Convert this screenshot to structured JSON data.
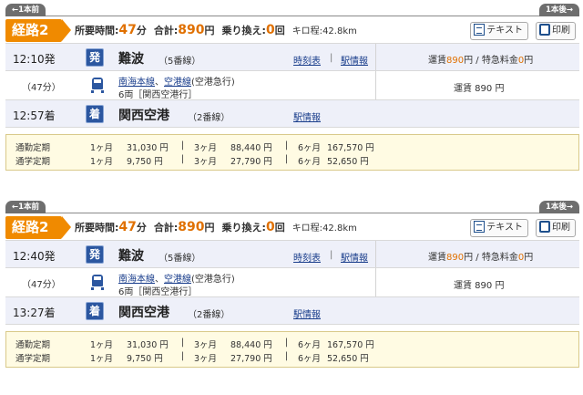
{
  "routes": [
    {
      "nav_prev": "←1本前",
      "nav_next": "1本後→",
      "badge": "経路2",
      "summary": {
        "time_label": "所要時間:",
        "time_value": "47",
        "time_unit": "分",
        "total_label": "合計:",
        "total_value": "890",
        "total_unit": "円",
        "transfer_label": "乗り換え:",
        "transfer_value": "0",
        "transfer_unit": "回",
        "distance_label": "キロ程:",
        "distance_value": "42.8km"
      },
      "buttons": {
        "text": "テキスト",
        "print": "印刷"
      },
      "depart": {
        "time": "12:10発",
        "badge": "発",
        "station": "難波",
        "platform": "（5番線）",
        "timetable": "時刻表",
        "sep": "|",
        "station_info": "駅情報",
        "fare_prefix": "運賃",
        "fare_value": "890",
        "fare_mid": "円 / 特急料金",
        "express_value": "0",
        "fare_suffix": "円"
      },
      "segment": {
        "duration": "（47分）",
        "line1": "南海本線",
        "line_sep": "、",
        "line2": "空港線",
        "line_type": "(空港急行)",
        "cars": "6両［関西空港行］",
        "fare": "運賃 890 円"
      },
      "arrive": {
        "time": "12:57着",
        "badge": "着",
        "station": "関西空港",
        "platform": "（2番線）",
        "station_info": "駅情報"
      },
      "passes": [
        {
          "type": "通勤定期",
          "p1": "1ヶ月",
          "v1": "31,030 円",
          "p3": "3ヶ月",
          "v3": "88,440 円",
          "p6": "6ヶ月",
          "v6": "167,570 円"
        },
        {
          "type": "通学定期",
          "p1": "1ヶ月",
          "v1": "9,750 円",
          "p3": "3ヶ月",
          "v3": "27,790 円",
          "p6": "6ヶ月",
          "v6": "52,650 円"
        }
      ],
      "sep": "|"
    },
    {
      "nav_prev": "←1本前",
      "nav_next": "1本後→",
      "badge": "経路2",
      "summary": {
        "time_label": "所要時間:",
        "time_value": "47",
        "time_unit": "分",
        "total_label": "合計:",
        "total_value": "890",
        "total_unit": "円",
        "transfer_label": "乗り換え:",
        "transfer_value": "0",
        "transfer_unit": "回",
        "distance_label": "キロ程:",
        "distance_value": "42.8km"
      },
      "buttons": {
        "text": "テキスト",
        "print": "印刷"
      },
      "depart": {
        "time": "12:40発",
        "badge": "発",
        "station": "難波",
        "platform": "（5番線）",
        "timetable": "時刻表",
        "sep": "|",
        "station_info": "駅情報",
        "fare_prefix": "運賃",
        "fare_value": "890",
        "fare_mid": "円 / 特急料金",
        "express_value": "0",
        "fare_suffix": "円"
      },
      "segment": {
        "duration": "（47分）",
        "line1": "南海本線",
        "line_sep": "、",
        "line2": "空港線",
        "line_type": "(空港急行)",
        "cars": "6両［関西空港行］",
        "fare": "運賃 890 円"
      },
      "arrive": {
        "time": "13:27着",
        "badge": "着",
        "station": "関西空港",
        "platform": "（2番線）",
        "station_info": "駅情報"
      },
      "passes": [
        {
          "type": "通勤定期",
          "p1": "1ヶ月",
          "v1": "31,030 円",
          "p3": "3ヶ月",
          "v3": "88,440 円",
          "p6": "6ヶ月",
          "v6": "167,570 円"
        },
        {
          "type": "通学定期",
          "p1": "1ヶ月",
          "v1": "9,750 円",
          "p3": "3ヶ月",
          "v3": "27,790 円",
          "p6": "6ヶ月",
          "v6": "52,650 円"
        }
      ],
      "sep": "|"
    }
  ],
  "colors": {
    "accent": "#f08a00",
    "link": "#1a3e8c",
    "station_badge": "#2c57a0",
    "station_row": "#eef0f9",
    "pass_bg": "#fffbe3"
  }
}
